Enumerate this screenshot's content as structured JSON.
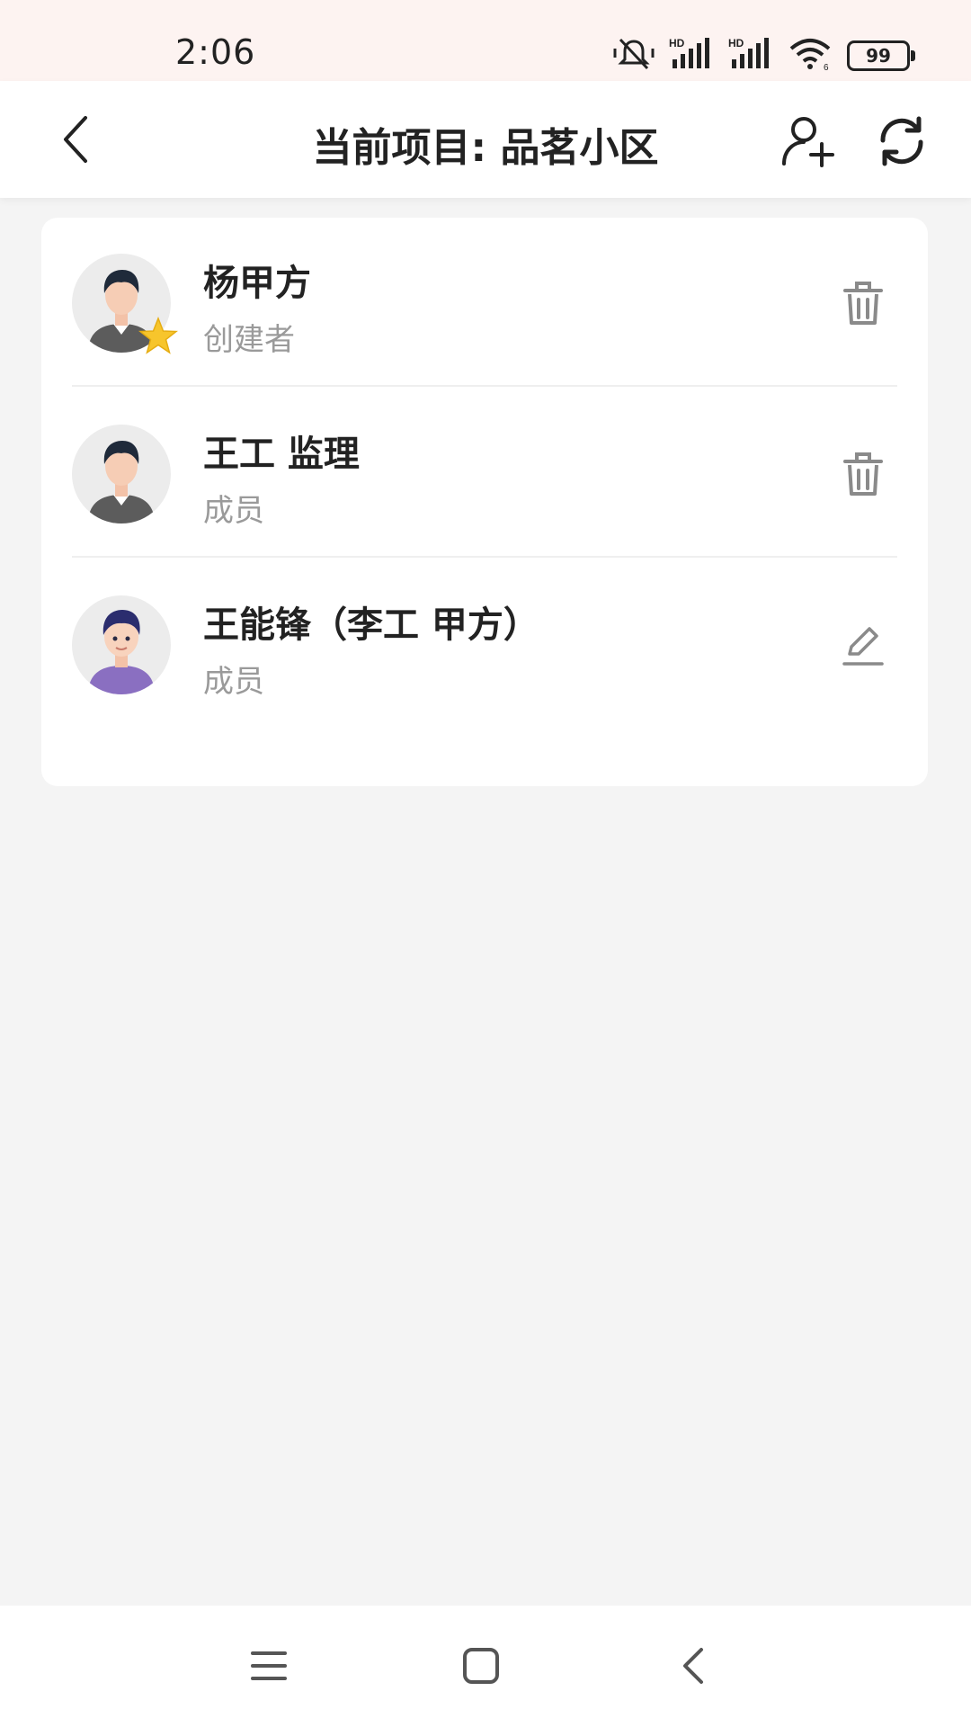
{
  "status_bar": {
    "time": "2:06",
    "battery": "99",
    "icons": [
      "mute-vibrate-icon",
      "signal-hd-icon",
      "signal-hd-icon",
      "wifi-icon",
      "battery-icon"
    ]
  },
  "header": {
    "title": "当前项目: 品茗小区",
    "icons": [
      "back-icon",
      "add-member-icon",
      "refresh-icon"
    ]
  },
  "members": [
    {
      "name": "杨甲方",
      "role": "创建者",
      "action_icon": "trash-icon",
      "badge_icon": "star-icon"
    },
    {
      "name": "王工 监理",
      "role": "成员",
      "action_icon": "trash-icon"
    },
    {
      "name": "王能锋（李工 甲方）",
      "role": "成员",
      "action_icon": "edit-icon"
    }
  ],
  "nav_bar": {
    "icons": [
      "menu-icon",
      "home-icon",
      "back-icon"
    ]
  },
  "colors": {
    "status_bg": "#fdf3f1",
    "page_bg": "#f4f4f4",
    "secondary_text": "#9a9a9a",
    "star": "#f7c52c"
  }
}
